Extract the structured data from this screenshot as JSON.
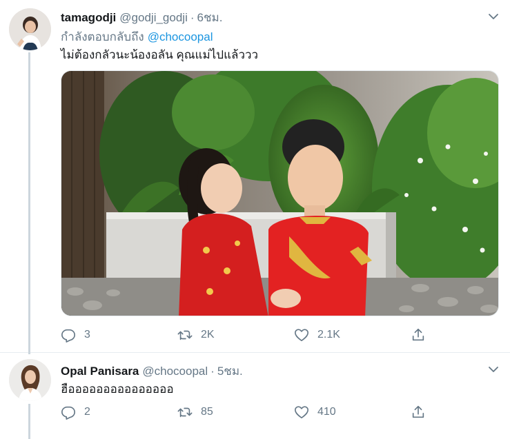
{
  "tweets": [
    {
      "display_name": "tamagodji",
      "handle": "@godji_godji",
      "separator": "·",
      "time": "6ชม.",
      "replying_prefix": "กำลังตอบกลับถึง",
      "replying_to": "@chocoopal",
      "text": "ไม่ต้องกลัวนะน้องอลัน คุณแม่ไปแล้ววว",
      "stats": {
        "replies": "3",
        "retweets": "2K",
        "likes": "2.1K"
      }
    },
    {
      "display_name": "Opal Panisara",
      "handle": "@chocoopal",
      "separator": "·",
      "time": "5ชม.",
      "text": "ฮือออออออออออออออ",
      "stats": {
        "replies": "2",
        "retweets": "85",
        "likes": "410"
      }
    }
  ],
  "icons": [
    "chevron-down-icon",
    "reply-icon",
    "retweet-icon",
    "like-icon",
    "share-icon"
  ],
  "colors": {
    "link": "#1b95e0",
    "secondary_text": "#657786",
    "thread_line": "#ccd6dd"
  }
}
